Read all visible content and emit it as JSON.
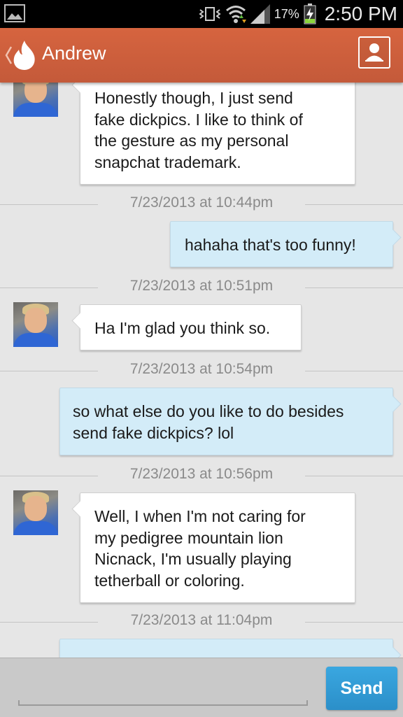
{
  "status_bar": {
    "battery": "17%",
    "time": "2:50 PM",
    "icons": [
      "image-icon",
      "vibrate-icon",
      "wifi-icon",
      "signal-icon",
      "battery-charging-icon"
    ]
  },
  "header": {
    "title": "Andrew",
    "back_icon": "chevron-left-icon",
    "logo_icon": "flame-icon",
    "action_icon": "contact-icon"
  },
  "messages": [
    {
      "type": "in",
      "text": "Honestly though, I just send\nfake dickpics. I like to think of\nthe gesture as my personal\nsnapchat trademark."
    },
    {
      "type": "timestamp",
      "text": "7/23/2013 at 10:44pm"
    },
    {
      "type": "out",
      "text": "hahaha that's too funny!"
    },
    {
      "type": "timestamp",
      "text": "7/23/2013 at 10:51pm"
    },
    {
      "type": "in",
      "text": "Ha I'm glad you think so."
    },
    {
      "type": "timestamp",
      "text": "7/23/2013 at 10:54pm"
    },
    {
      "type": "out",
      "text": "so what else do you like to do besides\nsend fake dickpics? lol"
    },
    {
      "type": "timestamp",
      "text": "7/23/2013 at 10:56pm"
    },
    {
      "type": "in",
      "text": "Well, I when I'm not caring for\nmy pedigree mountain lion\nNicnack, I'm usually playing\ntetherball or coloring."
    },
    {
      "type": "timestamp",
      "text": "7/23/2013 at 11:04pm"
    },
    {
      "type": "out",
      "text": ""
    }
  ],
  "compose": {
    "placeholder": "",
    "send_label": "Send"
  },
  "colors": {
    "header": "#d6643f",
    "incoming_bubble": "#ffffff",
    "outgoing_bubble": "#d3ecf8",
    "send_button": "#3aa7e0",
    "background": "#e6e6e6"
  }
}
